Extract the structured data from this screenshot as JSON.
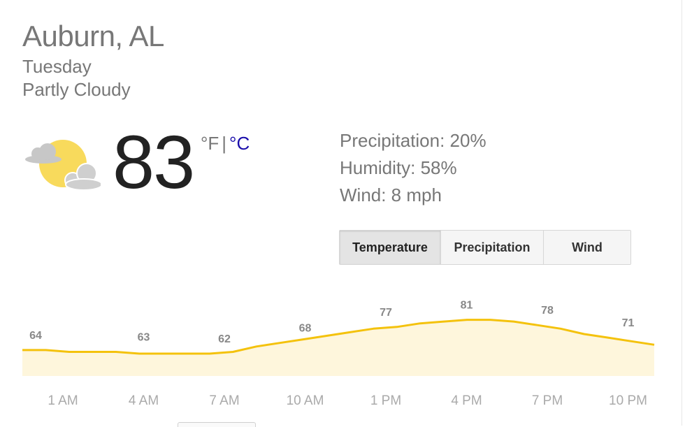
{
  "location": "Auburn, AL",
  "day": "Tuesday",
  "condition": "Partly Cloudy",
  "icon": "partly-cloudy-icon",
  "temperature": "83",
  "units": {
    "fahrenheit": "°F",
    "separator": "|",
    "celsius": "°C"
  },
  "details": {
    "precipitation": "Precipitation: 20%",
    "humidity": "Humidity: 58%",
    "wind": "Wind: 8 mph"
  },
  "tabs": [
    {
      "label": "Temperature",
      "active": true
    },
    {
      "label": "Precipitation",
      "active": false
    },
    {
      "label": "Wind",
      "active": false
    }
  ],
  "colors": {
    "line": "#f4c20d",
    "fill": "#fef6dc",
    "sun": "#f8da5c",
    "cloud": "#c7c7c7",
    "link": "#1a0dab"
  },
  "chart_data": {
    "type": "area",
    "x": [
      "1 AM",
      "4 AM",
      "7 AM",
      "10 AM",
      "1 PM",
      "4 PM",
      "7 PM",
      "10 PM"
    ],
    "labeled_values": [
      64,
      63,
      62,
      68,
      77,
      81,
      78,
      71
    ],
    "hourly_values": [
      64,
      64,
      63,
      63,
      63,
      62,
      62,
      62,
      62,
      63,
      66,
      68,
      70,
      72,
      74,
      76,
      77,
      79,
      80,
      81,
      81,
      80,
      78,
      76,
      73,
      71,
      69,
      67
    ],
    "title": "",
    "xlabel": "",
    "ylabel": ""
  }
}
